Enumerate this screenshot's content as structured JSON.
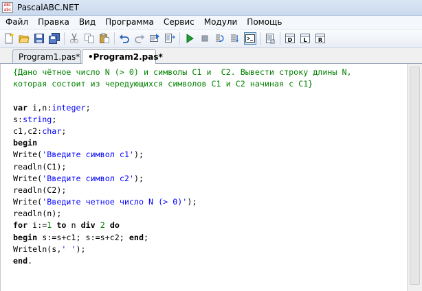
{
  "window": {
    "title": "PascalABC.NET",
    "icon_text": [
      "ABC",
      "abc"
    ]
  },
  "menu": [
    "Файл",
    "Правка",
    "Вид",
    "Программа",
    "Сервис",
    "Модули",
    "Помощь"
  ],
  "toolbar": {
    "icons": [
      "new-file-icon",
      "open-icon",
      "save-icon",
      "save-all-icon",
      "cut-icon",
      "copy-icon",
      "paste-icon",
      "undo-icon",
      "redo-icon",
      "find-icon",
      "replace-icon",
      "run-icon",
      "stop-icon",
      "step-over-icon",
      "step-into-icon",
      "output-window-icon",
      "compile-icon",
      "debug-d-icon",
      "debug-l-icon",
      "debug-r-icon"
    ]
  },
  "tabs": [
    {
      "label": "Program1.pas*",
      "active": false
    },
    {
      "label": "•Program2.pas*",
      "active": true
    }
  ],
  "editor": {
    "lines": [
      [
        {
          "t": "{Дано чётное число N (> 0) и символы C1 и  C2. Вывести строку длины N,",
          "c": "cmt"
        }
      ],
      [
        {
          "t": "которая состоит из чередующихся символов C1 и C2 начиная с C1}",
          "c": "cmt"
        }
      ],
      [
        {
          "t": "",
          "c": ""
        }
      ],
      [
        {
          "t": "var",
          "c": "kw"
        },
        {
          "t": " i,n:",
          "c": ""
        },
        {
          "t": "integer",
          "c": "type"
        },
        {
          "t": ";",
          "c": ""
        }
      ],
      [
        {
          "t": "s:",
          "c": ""
        },
        {
          "t": "string",
          "c": "type"
        },
        {
          "t": ";",
          "c": ""
        }
      ],
      [
        {
          "t": "c1,c2:",
          "c": ""
        },
        {
          "t": "char",
          "c": "type"
        },
        {
          "t": ";",
          "c": ""
        }
      ],
      [
        {
          "t": "begin",
          "c": "kw"
        }
      ],
      [
        {
          "t": "Write(",
          "c": ""
        },
        {
          "t": "'Введите символ c1'",
          "c": "str"
        },
        {
          "t": ");",
          "c": ""
        }
      ],
      [
        {
          "t": "readln(C1);",
          "c": ""
        }
      ],
      [
        {
          "t": "Write(",
          "c": ""
        },
        {
          "t": "'Введите символ c2'",
          "c": "str"
        },
        {
          "t": ");",
          "c": ""
        }
      ],
      [
        {
          "t": "readln(C2);",
          "c": ""
        }
      ],
      [
        {
          "t": "Write(",
          "c": ""
        },
        {
          "t": "'Введите четное число N (> 0)'",
          "c": "str"
        },
        {
          "t": ");",
          "c": ""
        }
      ],
      [
        {
          "t": "readln(n);",
          "c": ""
        }
      ],
      [
        {
          "t": "for",
          "c": "kw"
        },
        {
          "t": " i:=",
          "c": ""
        },
        {
          "t": "1",
          "c": "num"
        },
        {
          "t": " ",
          "c": ""
        },
        {
          "t": "to",
          "c": "kw"
        },
        {
          "t": " n ",
          "c": ""
        },
        {
          "t": "div",
          "c": "kw"
        },
        {
          "t": " ",
          "c": ""
        },
        {
          "t": "2",
          "c": "num"
        },
        {
          "t": " ",
          "c": ""
        },
        {
          "t": "do",
          "c": "kw"
        }
      ],
      [
        {
          "t": "begin",
          "c": "kw"
        },
        {
          "t": " s:=s+c1; s:=s+c2; ",
          "c": ""
        },
        {
          "t": "end",
          "c": "kw"
        },
        {
          "t": ";",
          "c": ""
        }
      ],
      [
        {
          "t": "Writeln(s,",
          "c": ""
        },
        {
          "t": "' '",
          "c": "str"
        },
        {
          "t": ");",
          "c": ""
        }
      ],
      [
        {
          "t": "end",
          "c": "kw"
        },
        {
          "t": ".",
          "c": ""
        }
      ]
    ]
  }
}
